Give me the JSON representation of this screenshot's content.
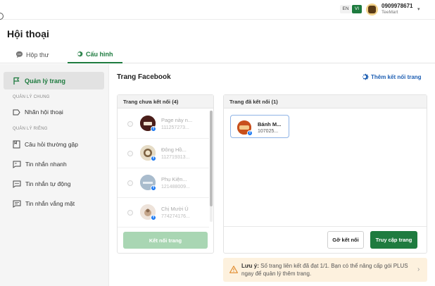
{
  "header": {
    "languages": {
      "en": "EN",
      "vi": "VI"
    },
    "account": {
      "phone": "0909978671",
      "name": "TeeMart"
    }
  },
  "page_title": "Hội thoại",
  "tabs": [
    {
      "label": "Hộp thư",
      "icon": "chat-bubble-icon"
    },
    {
      "label": "Cấu hình",
      "icon": "gear-icon",
      "active": true
    }
  ],
  "sidebar": {
    "active_item": {
      "label": "Quản lý trang",
      "icon": "flag-icon"
    },
    "sections": [
      {
        "title": "QUẢN LÝ CHUNG",
        "items": [
          {
            "label": "Nhãn hội thoại",
            "icon": "tag-icon"
          }
        ]
      },
      {
        "title": "QUẢN LÝ RIÊNG",
        "items": [
          {
            "label": "Câu hỏi thường gặp",
            "icon": "bookmark-icon"
          },
          {
            "label": "Tin nhắn nhanh",
            "icon": "quote-message-icon"
          },
          {
            "label": "Tin nhắn tự động",
            "icon": "message-dots-icon"
          },
          {
            "label": "Tin nhắn vắng mặt",
            "icon": "message-lines-icon"
          }
        ]
      }
    ]
  },
  "content": {
    "title": "Trang Facebook",
    "add_link": "Thêm kết nối trang",
    "unconnected": {
      "header": "Trang chưa kết nối (4)",
      "pages": [
        {
          "name": "Page này n...",
          "id": "111257273..."
        },
        {
          "name": "Đông Hồ...",
          "id": "112719313..."
        },
        {
          "name": "Phụ Kiện...",
          "id": "121488009..."
        },
        {
          "name": "Chị Mười Ú",
          "id": "774274176..."
        }
      ],
      "connect_button": "Kết nối trang"
    },
    "connected": {
      "header": "Trang đã kết nối (1)",
      "pages": [
        {
          "name": "Bánh M...",
          "id": "107025..."
        }
      ],
      "disconnect_button": "Gỡ kết nối",
      "visit_button": "Truy cập trang"
    },
    "notice": {
      "label": "Lưu ý:",
      "text": "Số trang liên kết đã đạt 1/1. Bạn có thể nâng cấp gói PLUS ngay để quản lý thêm trang."
    }
  },
  "colors": {
    "brand_green": "#1e7b3f",
    "link_blue": "#1e5fb3",
    "facebook_blue": "#1877f2",
    "notice_bg": "#fdf1de"
  }
}
